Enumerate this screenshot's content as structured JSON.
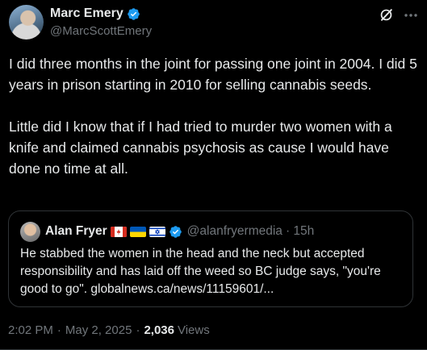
{
  "author": {
    "name": "Marc Emery",
    "handle": "@MarcScottEmery"
  },
  "post": {
    "text": "I did three months in the joint for passing one joint in 2004. I did 5 years in prison starting in 2010 for selling cannabis seeds.\n\nLittle did I know that if I had tried to murder two women with a knife and claimed cannabis psychosis as cause I would have done no time at all."
  },
  "quoted": {
    "name": "Alan Fryer",
    "flags": [
      "canada-flag",
      "ukraine-flag",
      "israel-flag"
    ],
    "handle": "@alanfryermedia",
    "time": "· 15h",
    "text": "He stabbed the women in the head and the neck but accepted responsibility and has laid off the weed so BC judge says, \"you're good to go\". globalnews.ca/news/11159601/..."
  },
  "meta": {
    "time": "2:02 PM",
    "date": "May 2, 2025",
    "views_count": "2,036",
    "views_label": "Views"
  },
  "colors": {
    "background": "#000000",
    "verified": "#1d9bf0",
    "secondary_text": "#71767b"
  }
}
